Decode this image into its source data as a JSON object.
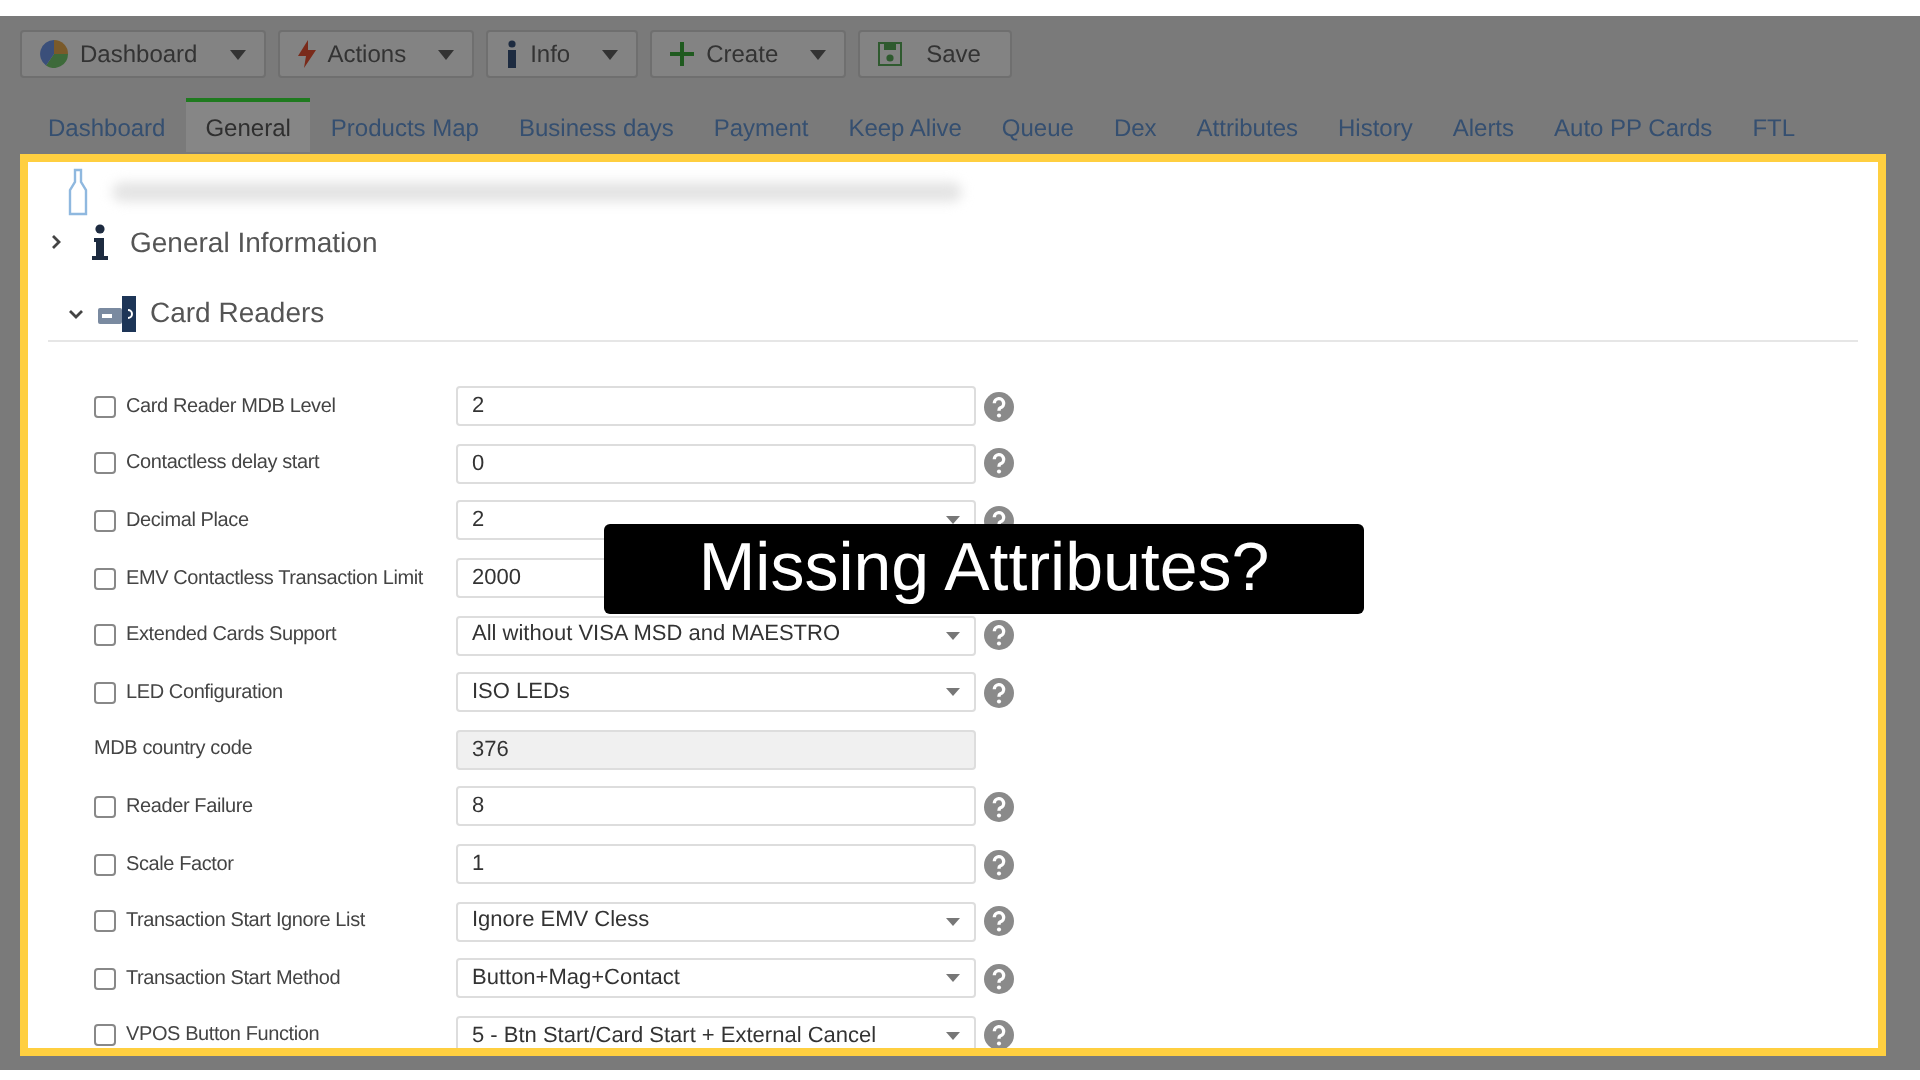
{
  "toolbar": [
    {
      "label": "Dashboard",
      "dropdown": true
    },
    {
      "label": "Actions",
      "dropdown": true
    },
    {
      "label": "Info",
      "dropdown": true
    },
    {
      "label": "Create",
      "dropdown": true
    },
    {
      "label": "Save",
      "dropdown": false
    }
  ],
  "tabs": [
    {
      "label": "Dashboard",
      "selected": false
    },
    {
      "label": "General",
      "selected": true
    },
    {
      "label": "Products Map",
      "selected": false
    },
    {
      "label": "Business days",
      "selected": false
    },
    {
      "label": "Payment",
      "selected": false
    },
    {
      "label": "Keep Alive",
      "selected": false
    },
    {
      "label": "Queue",
      "selected": false
    },
    {
      "label": "Dex",
      "selected": false
    },
    {
      "label": "Attributes",
      "selected": false
    },
    {
      "label": "History",
      "selected": false
    },
    {
      "label": "Alerts",
      "selected": false
    },
    {
      "label": "Auto PP Cards",
      "selected": false
    },
    {
      "label": "FTL",
      "selected": false
    }
  ],
  "sections": [
    {
      "title": "General Information",
      "expanded": false
    },
    {
      "title": "Card Readers",
      "expanded": true
    }
  ],
  "fields": [
    {
      "label": "Card Reader MDB Level",
      "kind": "text",
      "value": "2",
      "checked": false,
      "help": true
    },
    {
      "label": "Contactless delay start",
      "kind": "text",
      "value": "0",
      "checked": false,
      "help": true
    },
    {
      "label": "Decimal Place",
      "kind": "select",
      "value": "2",
      "checked": false,
      "help": true
    },
    {
      "label": "EMV Contactless Transaction Limit",
      "kind": "text",
      "value": "2000",
      "checked": false,
      "help": false
    },
    {
      "label": "Extended Cards Support",
      "kind": "select",
      "value": "All without VISA MSD and MAESTRO",
      "checked": false,
      "help": true
    },
    {
      "label": "LED Configuration",
      "kind": "select",
      "value": "ISO LEDs",
      "checked": false,
      "help": true
    },
    {
      "label": "MDB country code",
      "kind": "readonly",
      "value": "376",
      "help": false
    },
    {
      "label": "Reader Failure",
      "kind": "text",
      "value": "8",
      "checked": false,
      "help": true
    },
    {
      "label": "Scale Factor",
      "kind": "text",
      "value": "1",
      "checked": false,
      "help": true
    },
    {
      "label": "Transaction Start Ignore List",
      "kind": "select",
      "value": "Ignore EMV Cless",
      "checked": false,
      "help": true
    },
    {
      "label": "Transaction Start Method",
      "kind": "select",
      "value": "Button+Mag+Contact",
      "checked": false,
      "help": true
    },
    {
      "label": "VPOS Button Function",
      "kind": "select",
      "value": "5 - Btn Start/Card Start + External Cancel",
      "checked": false,
      "help": true
    }
  ],
  "caption": "Missing Attributes?"
}
